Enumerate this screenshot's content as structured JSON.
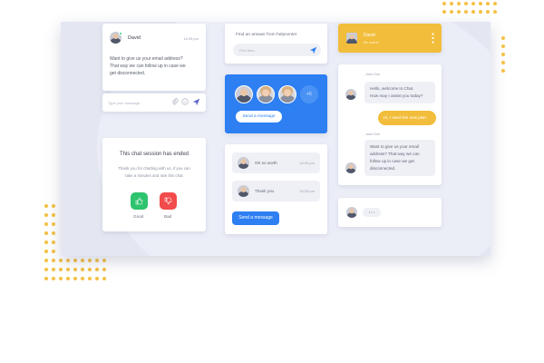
{
  "chat_card": {
    "agent_name": "David",
    "time": "14:35 pm",
    "message_lines": [
      "Want to give us your email address?",
      "That way we can follow up in case we",
      "get disconnected."
    ],
    "input_placeholder": "Type your message..."
  },
  "helpcenter": {
    "title": "Find an answer from helpcenter",
    "search_placeholder": "Find item..."
  },
  "team_card": {
    "more_count": "+6",
    "button_label": "Send a message"
  },
  "header_card": {
    "name": "David",
    "status": "Be online"
  },
  "conversation": {
    "sender_1": "John Doe",
    "agent_lines_1": [
      "Hello, welcome to Chat.",
      "How may I assist you today?"
    ],
    "user_reply": "Hi, I need the new plan.",
    "sender_2": "John Doe",
    "agent_lines_2": [
      "Want to give us your email",
      "address? That way we can",
      "follow up in case we get",
      "disconnected."
    ]
  },
  "ended_card": {
    "title": "This chat session has ended",
    "text_lines": [
      "Thank you for chatting with us, if you can",
      "take a minutes and rate this chat"
    ],
    "good_label": "Good",
    "bad_label": "Bad"
  },
  "list_card": {
    "rows": [
      {
        "text": "OK so worth",
        "time": "14:20 pm"
      },
      {
        "text": "Thank you",
        "time": "15:25 pm"
      }
    ],
    "button_label": "Send a message"
  },
  "typing_card": {
    "text": "• • •"
  },
  "colors": {
    "accent_blue": "#2d7ff2",
    "accent_yellow": "#f2bd3a",
    "good_green": "#2ec36f",
    "bad_red": "#f24b4b"
  }
}
